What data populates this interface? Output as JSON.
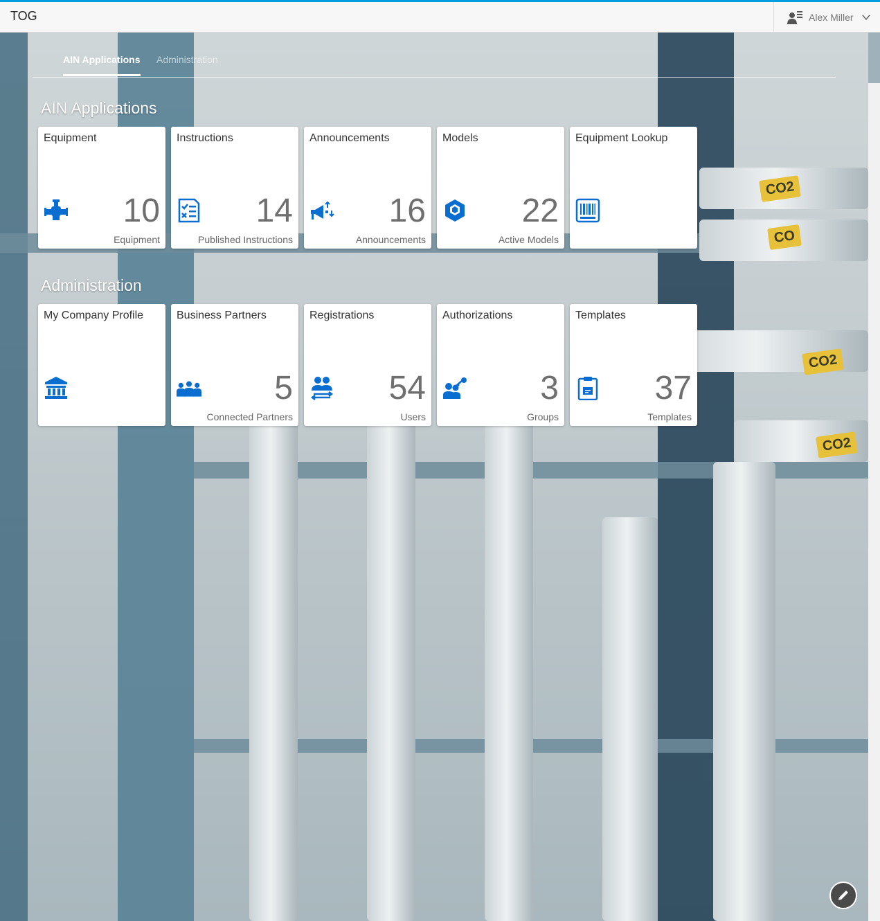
{
  "header": {
    "title": "TOG",
    "user_name": "Alex Miller"
  },
  "anchors": [
    {
      "label": "AIN Applications",
      "active": true
    },
    {
      "label": "Administration",
      "active": false
    }
  ],
  "groups": {
    "applications": {
      "title": "AIN Applications",
      "tiles": [
        {
          "title": "Equipment",
          "number": "10",
          "unit": "Equipment",
          "icon": "valve-icon"
        },
        {
          "title": "Instructions",
          "number": "14",
          "unit": "Published Instructions",
          "icon": "checklist-icon"
        },
        {
          "title": "Announcements",
          "number": "16",
          "unit": "Announcements",
          "icon": "megaphone-icon"
        },
        {
          "title": "Models",
          "number": "22",
          "unit": "Active Models",
          "icon": "cube-model-icon"
        },
        {
          "title": "Equipment Lookup",
          "number": "",
          "unit": "",
          "icon": "barcode-icon"
        }
      ]
    },
    "administration": {
      "title": "Administration",
      "tiles": [
        {
          "title": "My Company Profile",
          "number": "",
          "unit": "",
          "icon": "building-icon"
        },
        {
          "title": "Business Partners",
          "number": "5",
          "unit": "Connected Partners",
          "icon": "partners-icon"
        },
        {
          "title": "Registrations",
          "number": "54",
          "unit": "Users",
          "icon": "users-exchange-icon"
        },
        {
          "title": "Authorizations",
          "number": "3",
          "unit": "Groups",
          "icon": "user-key-icon"
        },
        {
          "title": "Templates",
          "number": "37",
          "unit": "Templates",
          "icon": "clipboard-icon"
        }
      ]
    }
  },
  "background_labels": [
    "CO2",
    "CO",
    "CO2",
    "CO2",
    "CO2"
  ],
  "colors": {
    "accent": "#009de0",
    "icon": "#0a6ed1"
  }
}
